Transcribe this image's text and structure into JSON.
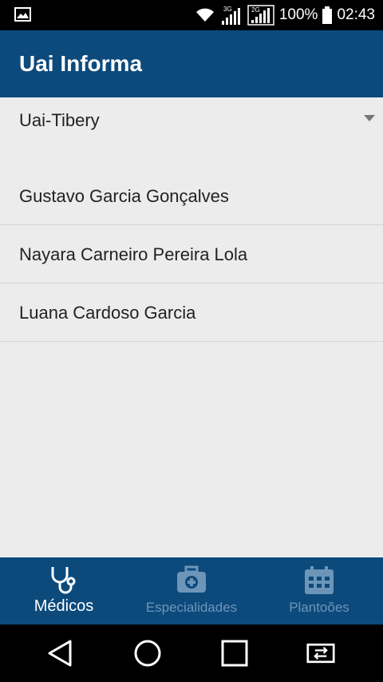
{
  "status_bar": {
    "battery": "100%",
    "time": "02:43",
    "network_1": "3G",
    "network_2": "2G",
    "icons": [
      "image-icon",
      "wifi-icon",
      "signal-3g-icon",
      "signal-2g-icon",
      "battery-icon"
    ]
  },
  "app_bar": {
    "title": "Uai Informa"
  },
  "spinner": {
    "selected": "Uai-Tibery"
  },
  "doctors": [
    {
      "name": "Gustavo Garcia Gonçalves"
    },
    {
      "name": "Nayara Carneiro Pereira Lola"
    },
    {
      "name": "Luana Cardoso Garcia"
    }
  ],
  "bottom_nav": {
    "tabs": [
      {
        "label": "Médicos",
        "icon": "stethoscope-icon",
        "active": true
      },
      {
        "label": "Especialidades",
        "icon": "medical-kit-icon",
        "active": false
      },
      {
        "label": "Plantoões",
        "icon": "calendar-icon",
        "active": false
      }
    ]
  },
  "colors": {
    "primary": "#0c4a7c",
    "background": "#ececec",
    "inactive_tab": "#6d95b8",
    "active_tab": "#ffffff"
  }
}
